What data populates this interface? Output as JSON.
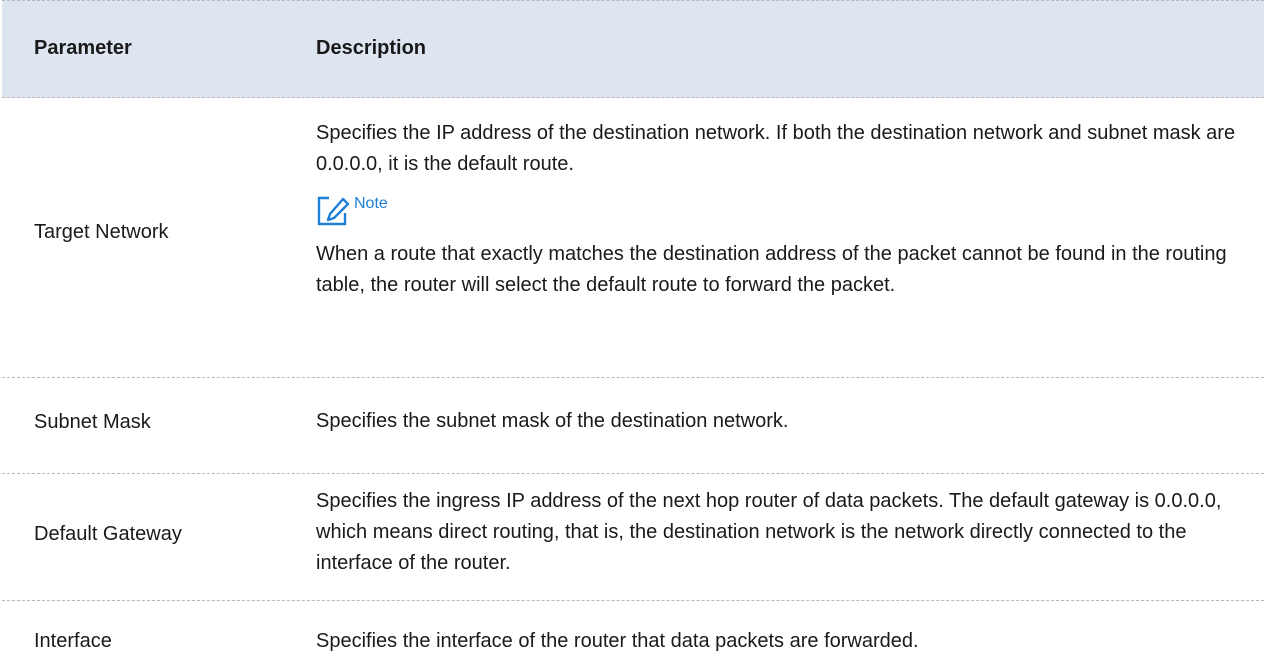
{
  "header": {
    "parameter": "Parameter",
    "description": "Description"
  },
  "rows": [
    {
      "parameter": "Target Network",
      "description": "Specifies the IP address of the destination network. If both the destination network and subnet mask are 0.0.0.0, it is the default route.",
      "note_label": "Note",
      "note_icon": "edit-note-icon",
      "note_text": "When a route that exactly matches the destination address of the packet cannot be found in the routing table, the router will select the default route to forward the packet."
    },
    {
      "parameter": "Subnet Mask",
      "description": "Specifies the subnet mask of the destination network."
    },
    {
      "parameter": "Default Gateway",
      "description": "Specifies the ingress IP address of the next hop router of data packets. The default gateway is 0.0.0.0, which means direct routing, that is, the destination network is the network directly connected to the interface of the router."
    },
    {
      "parameter": "Interface",
      "description": "Specifies the interface of the router that data packets are forwarded."
    }
  ],
  "colors": {
    "header_bg": "#dde6f0",
    "note_accent": "#1e7fd6",
    "divider": "#b8b8b8"
  }
}
